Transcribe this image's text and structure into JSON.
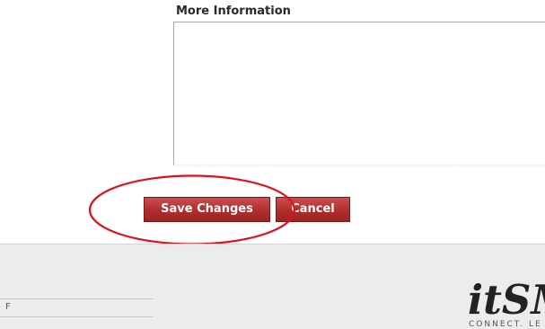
{
  "form": {
    "more_info_label": "More Information",
    "more_info_value": ""
  },
  "actions": {
    "save_label": "Save Changes",
    "cancel_label": "Cancel"
  },
  "annotation": {
    "highlight_color": "#e0101a"
  },
  "footer": {
    "link_text": "F",
    "logo_text": "itSM",
    "logo_tagline": "CONNECT. LE"
  },
  "colors": {
    "button_red": "#b2302f",
    "footer_bg": "#ececec",
    "link_blue": "#2b5fb2"
  }
}
